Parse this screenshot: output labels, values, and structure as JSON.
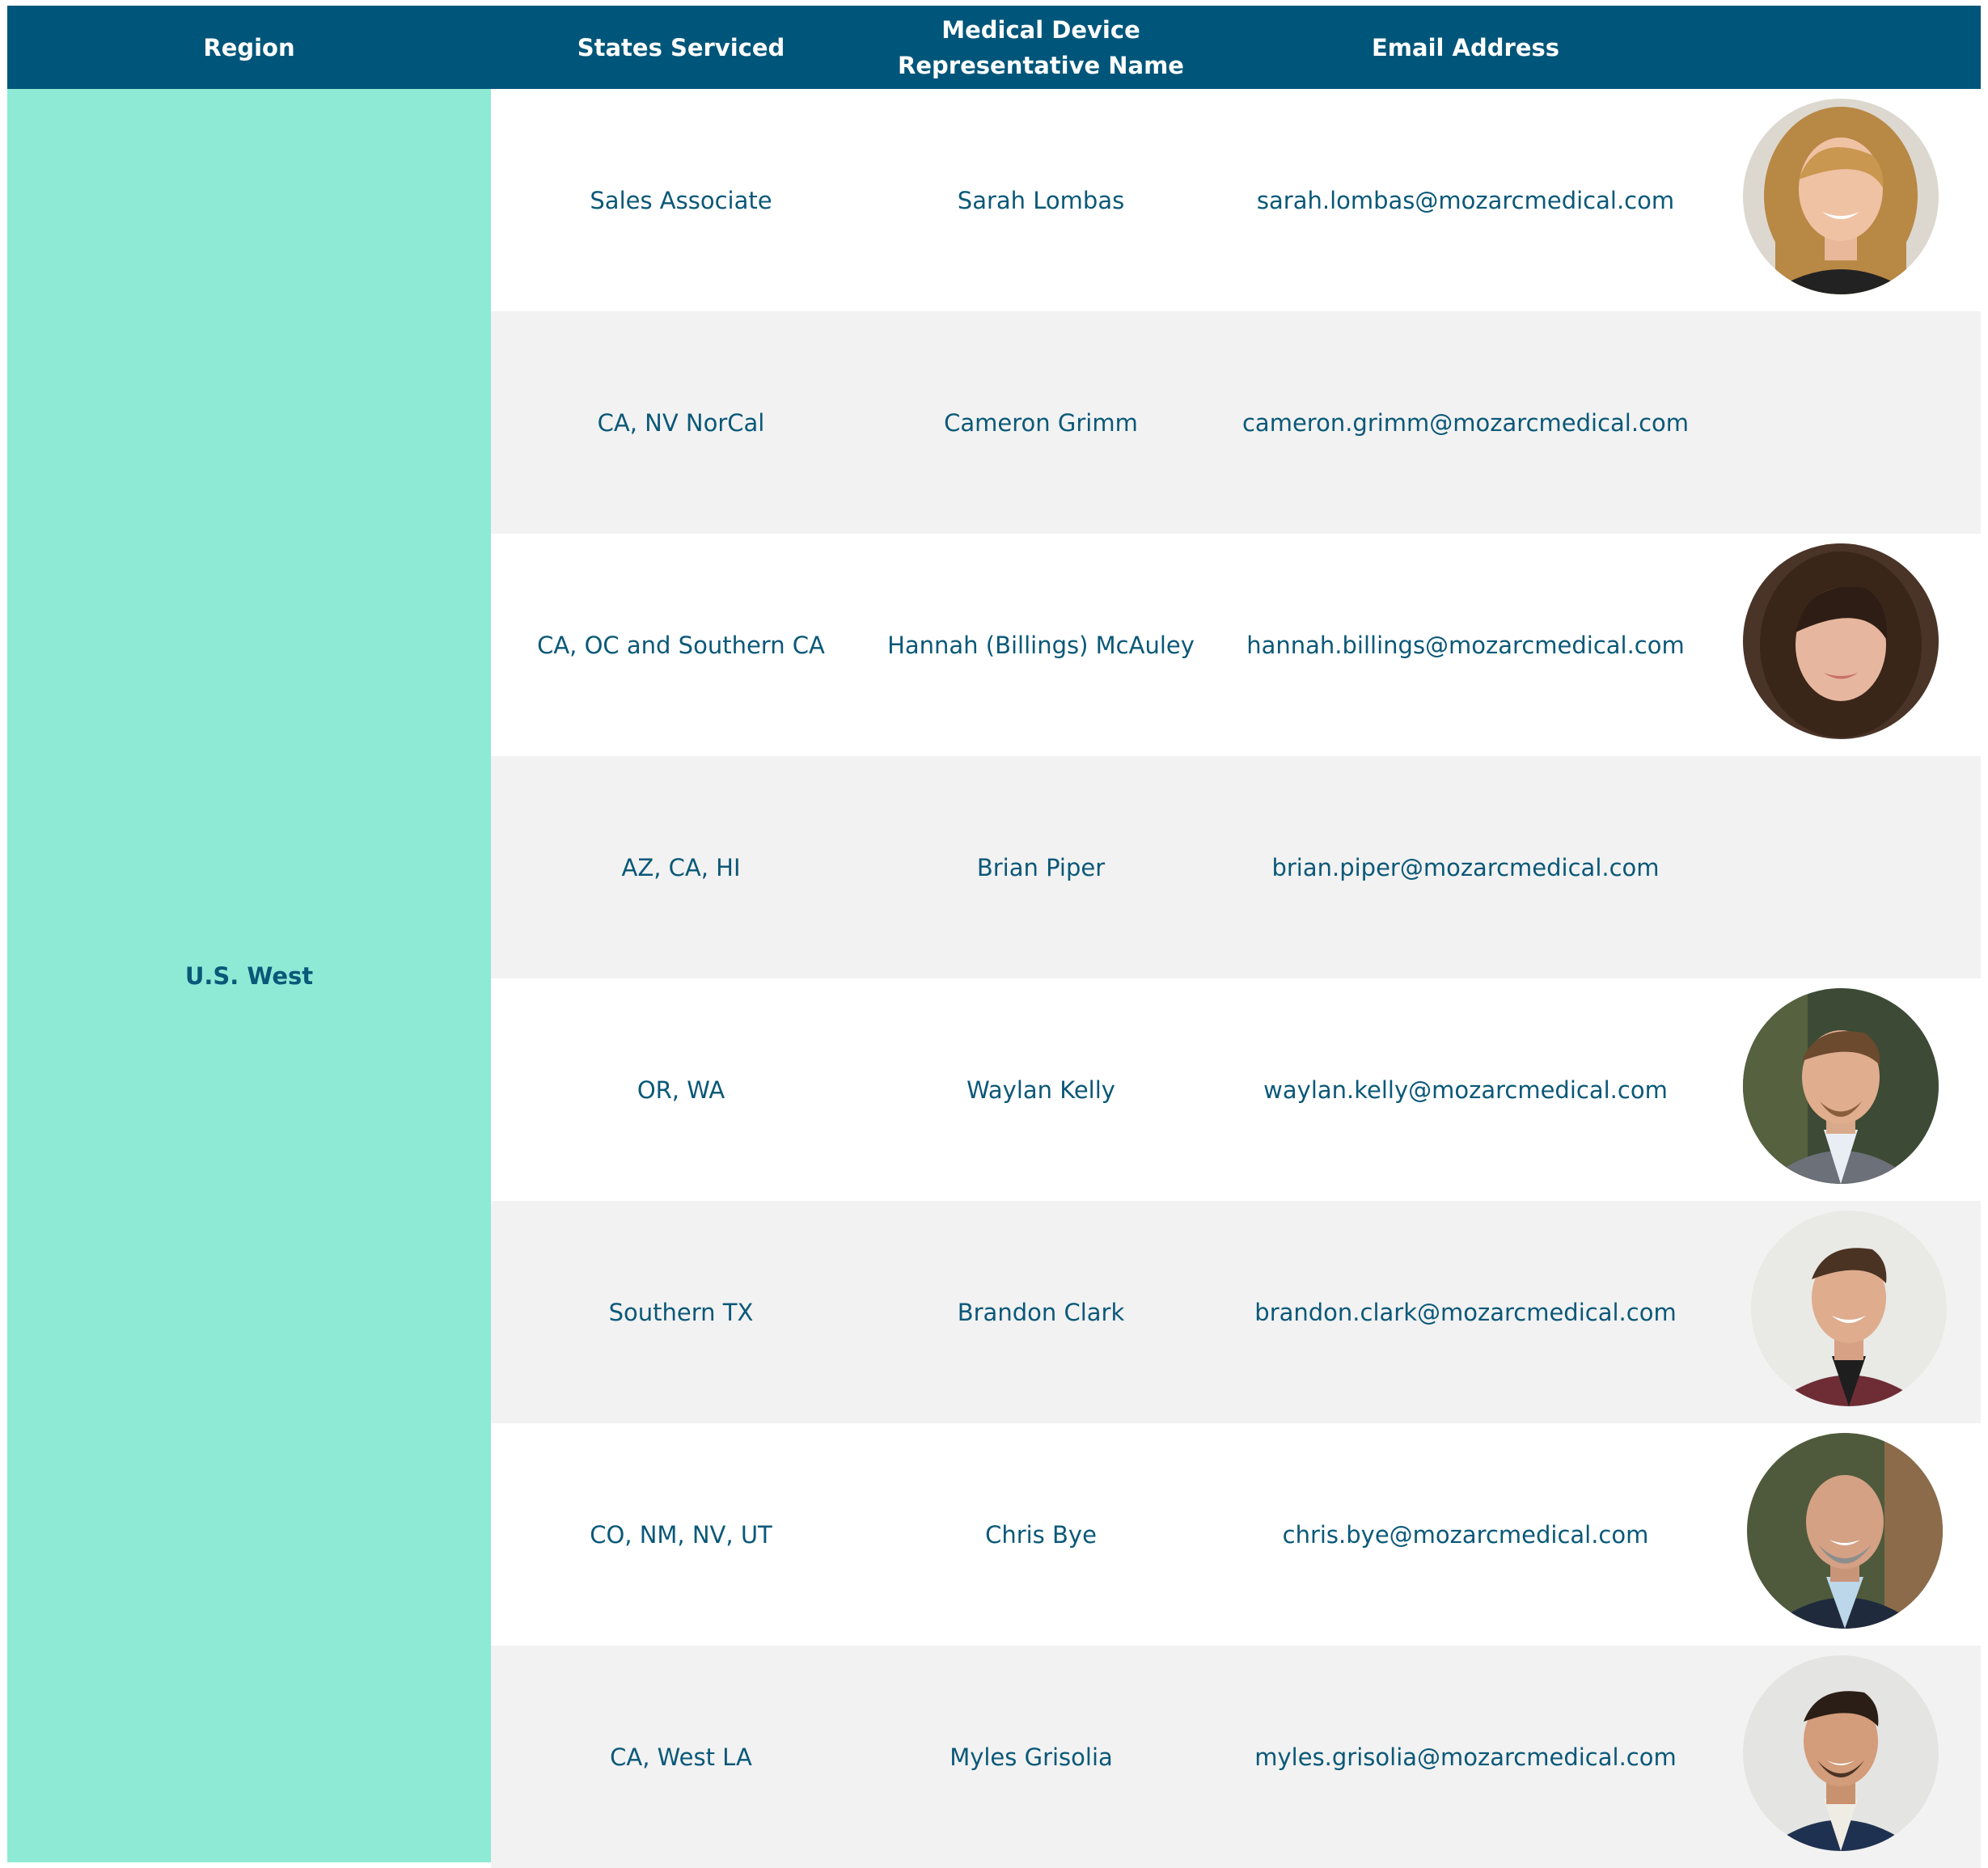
{
  "header": {
    "region": "Region",
    "states": "States Serviced",
    "name_line1": "Medical Device",
    "name_line2": "Representative Name",
    "email": "Email Address"
  },
  "region": "U.S. West",
  "colors": {
    "header_bg": "#00567a",
    "region_bg": "#8eead5",
    "text": "#0a5878",
    "row_alt": "#f2f2f2"
  },
  "rows": [
    {
      "states": "Sales Associate",
      "name": "Sarah Lombas",
      "email": "sarah.lombas@mozarcmedical.com",
      "photo": true
    },
    {
      "states": "CA, NV NorCal",
      "name": "Cameron Grimm",
      "email": "cameron.grimm@mozarcmedical.com",
      "photo": false
    },
    {
      "states": "CA, OC and Southern CA",
      "name": "Hannah (Billings) McAuley",
      "email": "hannah.billings@mozarcmedical.com",
      "photo": true
    },
    {
      "states": "AZ, CA, HI",
      "name": "Brian Piper",
      "email": "brian.piper@mozarcmedical.com",
      "photo": false
    },
    {
      "states": "OR, WA",
      "name": "Waylan Kelly",
      "email": "waylan.kelly@mozarcmedical.com",
      "photo": true
    },
    {
      "states": "Southern TX",
      "name": "Brandon Clark",
      "email": "brandon.clark@mozarcmedical.com",
      "photo": true
    },
    {
      "states": "CO, NM, NV, UT",
      "name": "Chris Bye",
      "email": "chris.bye@mozarcmedical.com",
      "photo": true
    },
    {
      "states": "CA, West LA",
      "name": "Myles Grisolia",
      "email": "myles.grisolia@mozarcmedical.com",
      "photo": true
    }
  ]
}
